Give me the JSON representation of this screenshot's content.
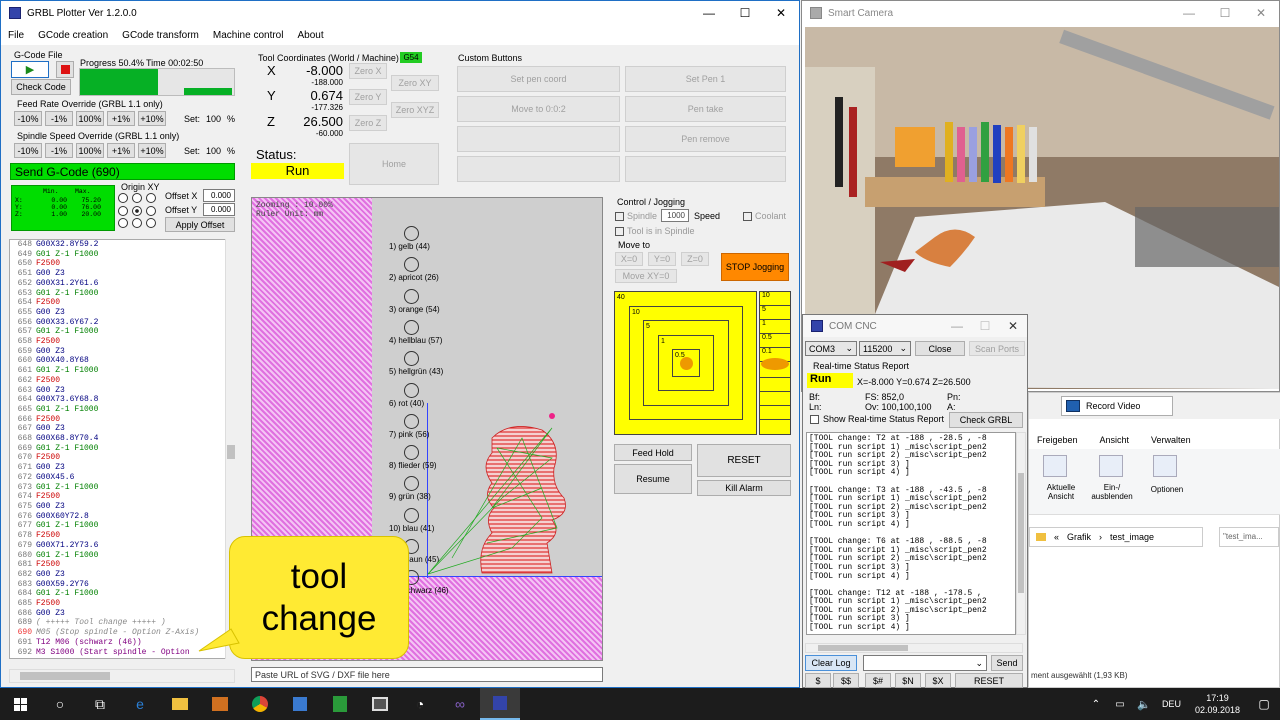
{
  "main": {
    "title": "GRBL Plotter Ver 1.2.0.0",
    "menu": [
      "File",
      "GCode creation",
      "GCode transform",
      "Machine control",
      "About"
    ]
  },
  "gcode_file": {
    "group": "G-Code File",
    "check": "Check Code",
    "progress": "Progress 50.4%",
    "time": "Time 00:02:50"
  },
  "feed": {
    "title": "Feed Rate Override (GRBL 1.1 only)",
    "buttons": [
      "-10%",
      "-1%",
      "100%",
      "+1%",
      "+10%"
    ],
    "set_label": "Set:",
    "set_value": "100",
    "unit": "%"
  },
  "spindle": {
    "title": "Spindle Speed Override (GRBL 1.1 only)",
    "buttons": [
      "-10%",
      "-1%",
      "100%",
      "+1%",
      "+10%"
    ],
    "set_label": "Set:",
    "set_value": "100",
    "unit": "%"
  },
  "send": {
    "label": "Send G-Code (690)"
  },
  "minmax": {
    "head": [
      "Min.",
      "Max."
    ],
    "rows": [
      [
        "X:",
        "0.00",
        "75.20"
      ],
      [
        "Y:",
        "0.00",
        "76.00"
      ],
      [
        "Z:",
        "1.00",
        "20.00"
      ]
    ]
  },
  "origin": {
    "title": "Origin XY",
    "offset_x": "Offset X",
    "offset_x_val": "0.000",
    "offset_y": "Offset Y",
    "offset_y_val": "0.000",
    "apply": "Apply Offset"
  },
  "coords": {
    "title": "Tool Coordinates (World / Machine)",
    "badge": "G54",
    "x": "X",
    "x_val": "-8.000",
    "x_mach": "-188.000",
    "y": "Y",
    "y_val": "0.674",
    "y_mach": "-177.326",
    "z": "Z",
    "z_val": "26.500",
    "z_mach": "-60.000",
    "zero_x": "Zero X",
    "zero_y": "Zero Y",
    "zero_z": "Zero Z",
    "zero_xy": "Zero XY",
    "zero_xyz": "Zero XYZ",
    "home": "Home",
    "status_label": "Status:",
    "status": "Run"
  },
  "custom": {
    "title": "Custom Buttons",
    "buttons": [
      "Set pen coord",
      "Set Pen 1",
      "Move to 0:0:2",
      "Pen take",
      "",
      "Pen remove",
      "",
      ""
    ]
  },
  "canvas": {
    "zoom": "Zooming   : 10.00%",
    "ruler": "Ruler Unit: mm",
    "tools": [
      "1) gelb (44)",
      "2) apricot (26)",
      "3) orange (54)",
      "4) hellblau (57)",
      "5) hellgrün (43)",
      "6) rot (40)",
      "7) pink (56)",
      "8) flieder (59)",
      "9) grün (38)",
      "10) blau (41)",
      "11) braun (45)",
      "12) schwarz (46)"
    ]
  },
  "url": {
    "placeholder": "Paste URL of SVG / DXF file here"
  },
  "callout": {
    "text": "tool change"
  },
  "jog": {
    "title": "Control / Jogging",
    "spindle": "Spindle",
    "spindle_val": "1000",
    "speed": "Speed",
    "coolant": "Coolant",
    "tool_in_spindle": "Tool is in Spindle",
    "move_to": "Move to",
    "x0": "X=0",
    "y0": "Y=0",
    "z0": "Z=0",
    "xy0": "Move XY=0",
    "stop": "STOP Jogging",
    "big_labels": [
      "40",
      "10",
      "5",
      "1",
      "0.5"
    ],
    "small_labels": [
      "10",
      "5",
      "1",
      "0.5",
      "0.1"
    ]
  },
  "controls": {
    "feed_hold": "Feed Hold",
    "reset": "RESET",
    "resume": "Resume",
    "kill": "Kill Alarm"
  },
  "code_lines": [
    [
      "648",
      "G00X32.8Y59.2",
      "g0"
    ],
    [
      "649",
      "G01 Z-1 F1000",
      "g1"
    ],
    [
      "650",
      "F2500",
      "f"
    ],
    [
      "651",
      "G00 Z3",
      "g0"
    ],
    [
      "652",
      "G00X31.2Y61.6",
      "g0"
    ],
    [
      "653",
      "G01 Z-1 F1000",
      "g1"
    ],
    [
      "654",
      "F2500",
      "f"
    ],
    [
      "655",
      "G00 Z3",
      "g0"
    ],
    [
      "656",
      "G00X33.6Y67.2",
      "g0"
    ],
    [
      "657",
      "G01 Z-1 F1000",
      "g1"
    ],
    [
      "658",
      "F2500",
      "f"
    ],
    [
      "659",
      "G00 Z3",
      "g0"
    ],
    [
      "660",
      "G00X40.8Y68",
      "g0"
    ],
    [
      "661",
      "G01 Z-1 F1000",
      "g1"
    ],
    [
      "662",
      "F2500",
      "f"
    ],
    [
      "663",
      "G00 Z3",
      "g0"
    ],
    [
      "664",
      "G00X73.6Y68.8",
      "g0"
    ],
    [
      "665",
      "G01 Z-1 F1000",
      "g1"
    ],
    [
      "666",
      "F2500",
      "f"
    ],
    [
      "667",
      "G00 Z3",
      "g0"
    ],
    [
      "668",
      "G00X68.8Y70.4",
      "g0"
    ],
    [
      "669",
      "G01 Z-1 F1000",
      "g1"
    ],
    [
      "670",
      "F2500",
      "f"
    ],
    [
      "671",
      "G00 Z3",
      "g0"
    ],
    [
      "672",
      "G00X45.6",
      "g0"
    ],
    [
      "673",
      "G01 Z-1 F1000",
      "g1"
    ],
    [
      "674",
      "F2500",
      "f"
    ],
    [
      "675",
      "G00 Z3",
      "g0"
    ],
    [
      "676",
      "G00X60Y72.8",
      "g0"
    ],
    [
      "677",
      "G01 Z-1 F1000",
      "g1"
    ],
    [
      "678",
      "F2500",
      "f"
    ],
    [
      "679",
      "G00X71.2Y73.6",
      "g0"
    ],
    [
      "680",
      "G01 Z-1 F1000",
      "g1"
    ],
    [
      "681",
      "F2500",
      "f"
    ],
    [
      "682",
      "G00 Z3",
      "g0"
    ],
    [
      "683",
      "G00X59.2Y76",
      "g0"
    ],
    [
      "684",
      "G01 Z-1 F1000",
      "g1"
    ],
    [
      "685",
      "F2500",
      "f"
    ],
    [
      "686",
      "G00 Z3",
      "g0"
    ],
    [
      "689",
      "( +++++ Tool change +++++ )",
      "cm"
    ],
    [
      "690",
      "M05 (Stop spindle - Option Z-Axis)",
      "cm2"
    ],
    [
      "691",
      "T12 M06 (schwarz (46))",
      "m"
    ],
    [
      "692",
      "M3 S1000 (Start spindle - Option",
      "m"
    ]
  ],
  "camera": {
    "title": "Smart Camera"
  },
  "com": {
    "title": "COM CNC",
    "port": "COM3",
    "baud": "115200",
    "close": "Close",
    "scan": "Scan Ports",
    "rt": "Real-time Status Report",
    "state": "Run",
    "pos": "X=-8.000 Y=0.674 Z=26.500",
    "bf": "Bf:",
    "fs": "FS:  852,0",
    "pn": "Pn:",
    "ln": "Ln:",
    "ov": "Ov:  100,100,100",
    "a": "A:",
    "show_rt": "Show Real-time Status Report",
    "check": "Check GRBL",
    "clear": "Clear Log",
    "send": "Send",
    "quick": [
      "$",
      "$$",
      "$#",
      "$N",
      "$X",
      "RESET"
    ],
    "log": [
      "[TOOL change: T2 at -188 , -28.5 , -8",
      "[TOOL run script 1) _misc\\script_pen2",
      "[TOOL run script 2) _misc\\script_pen2",
      "[TOOL run script 3) ]",
      "[TOOL run script 4) ]",
      "",
      "[TOOL change: T3 at -188 , -43.5 , -8",
      "[TOOL run script 1) _misc\\script_pen2",
      "[TOOL run script 2) _misc\\script_pen2",
      "[TOOL run script 3) ]",
      "[TOOL run script 4) ]",
      "",
      "[TOOL change: T6 at -188 , -88.5 , -8",
      "[TOOL run script 1) _misc\\script_pen2",
      "[TOOL run script 2) _misc\\script_pen2",
      "[TOOL run script 3) ]",
      "[TOOL run script 4) ]",
      "",
      "[TOOL change: T12 at -188 , -178.5 ,",
      "[TOOL run script 1) _misc\\script_pen2",
      "[TOOL run script 2) _misc\\script_pen2",
      "[TOOL run script 3) ]",
      "[TOOL run script 4) ]"
    ]
  },
  "explorer": {
    "record": "Record Video",
    "tabs": [
      "Freigeben",
      "Ansicht",
      "Verwalten"
    ],
    "ribbon1": "Aktuelle Ansicht",
    "ribbon2": "Ein-/ ausblenden",
    "ribbon3": "Optionen",
    "crumb1": "Grafik",
    "crumb2": "test_image",
    "search": "\"test_ima...",
    "status": "ment ausgewählt (1,93 KB)"
  },
  "taskbar": {
    "time": "17:19",
    "date": "02.09.2018",
    "lang": "DEU"
  },
  "colors": {
    "send_green": "#00dd00",
    "status_yellow": "#ffff00",
    "stop_orange": "#ff8800",
    "canvas_magenta": "#e070e0",
    "jog_yellow": "#ffff00"
  }
}
